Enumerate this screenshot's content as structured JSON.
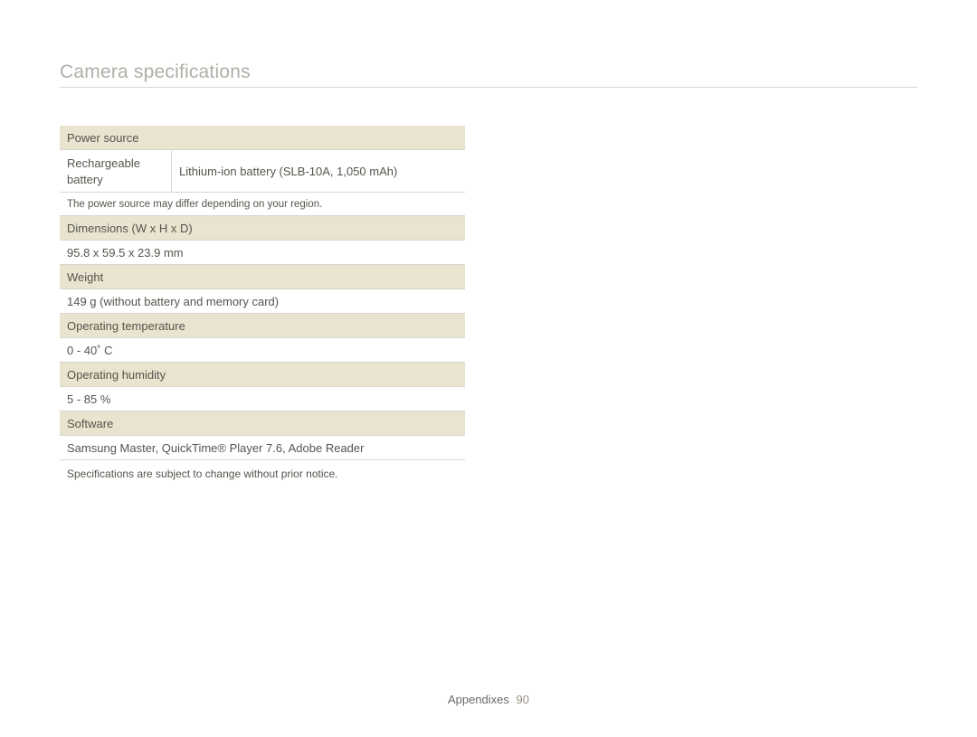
{
  "page": {
    "title": "Camera specifications"
  },
  "specs": {
    "power_source": {
      "header": "Power source",
      "row_label": "Rechargeable battery",
      "row_value": "Lithium-ion battery (SLB-10A, 1,050 mAh)",
      "note": "The power source may differ depending on your region."
    },
    "dimensions": {
      "header": "Dimensions (W x H x D)",
      "value": "95.8 x 59.5 x 23.9 mm"
    },
    "weight": {
      "header": "Weight",
      "value": "149 g (without battery and memory card)"
    },
    "op_temp": {
      "header": "Operating temperature",
      "value": "0 - 40˚ C"
    },
    "op_humidity": {
      "header": "Operating humidity",
      "value": "5 - 85 %"
    },
    "software": {
      "header": "Software",
      "value": "Samsung Master, QuickTime® Player 7.6, Adobe Reader"
    },
    "footnote": "Specifications are subject to change without prior notice."
  },
  "footer": {
    "section": "Appendixes",
    "page_number": "90"
  }
}
